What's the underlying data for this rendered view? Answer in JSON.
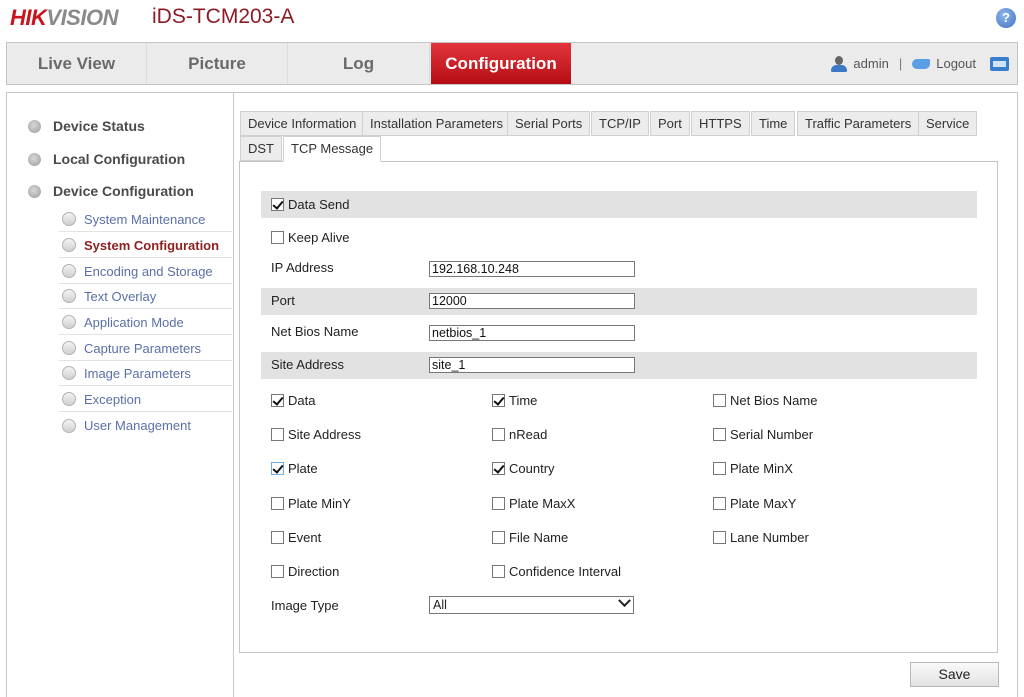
{
  "header": {
    "logo_part1": "HIK",
    "logo_part2": "VISION",
    "model": "iDS-TCM203-A",
    "help_label": "?"
  },
  "topnav": {
    "tabs": [
      {
        "label": "Live View",
        "active": false
      },
      {
        "label": "Picture",
        "active": false
      },
      {
        "label": "Log",
        "active": false
      },
      {
        "label": "Configuration",
        "active": true
      }
    ],
    "user": "admin",
    "separator": "|",
    "logout": "Logout"
  },
  "sidebar": {
    "top_items": [
      {
        "label": "Device Status"
      },
      {
        "label": "Local Configuration"
      },
      {
        "label": "Device Configuration"
      }
    ],
    "sub_items": [
      {
        "label": "System Maintenance",
        "active": false
      },
      {
        "label": "System Configuration",
        "active": true
      },
      {
        "label": "Encoding and Storage",
        "active": false
      },
      {
        "label": "Text Overlay",
        "active": false
      },
      {
        "label": "Application Mode",
        "active": false
      },
      {
        "label": "Capture Parameters",
        "active": false
      },
      {
        "label": "Image Parameters",
        "active": false
      },
      {
        "label": "Exception",
        "active": false
      },
      {
        "label": "User Management",
        "active": false
      }
    ]
  },
  "subtabs": [
    {
      "label": "Device Information",
      "active": false
    },
    {
      "label": "Installation Parameters",
      "active": false
    },
    {
      "label": "Serial Ports",
      "active": false
    },
    {
      "label": "TCP/IP",
      "active": false
    },
    {
      "label": "Port",
      "active": false
    },
    {
      "label": "HTTPS",
      "active": false
    },
    {
      "label": "Time",
      "active": false
    },
    {
      "label": "Traffic Parameters",
      "active": false
    },
    {
      "label": "Service",
      "active": false
    },
    {
      "label": "DST",
      "active": false
    },
    {
      "label": "TCP Message",
      "active": true
    }
  ],
  "form": {
    "data_send": {
      "label": "Data Send",
      "checked": true
    },
    "keep_alive": {
      "label": "Keep Alive",
      "checked": false
    },
    "ip_address": {
      "label": "IP Address",
      "value": "192.168.10.248"
    },
    "port": {
      "label": "Port",
      "value": "12000"
    },
    "net_bios_name": {
      "label": "Net Bios Name",
      "value": "netbios_1"
    },
    "site_address": {
      "label": "Site Address",
      "value": "site_1"
    },
    "fields": [
      {
        "label": "Data",
        "checked": true
      },
      {
        "label": "Time",
        "checked": true
      },
      {
        "label": "Net Bios Name",
        "checked": false
      },
      {
        "label": "Site Address",
        "checked": false
      },
      {
        "label": "nRead",
        "checked": false
      },
      {
        "label": "Serial Number",
        "checked": false
      },
      {
        "label": "Plate",
        "checked": true
      },
      {
        "label": "Country",
        "checked": true
      },
      {
        "label": "Plate MinX",
        "checked": false
      },
      {
        "label": "Plate MinY",
        "checked": false
      },
      {
        "label": "Plate MaxX",
        "checked": false
      },
      {
        "label": "Plate MaxY",
        "checked": false
      },
      {
        "label": "Event",
        "checked": false
      },
      {
        "label": "File Name",
        "checked": false
      },
      {
        "label": "Lane Number",
        "checked": false
      },
      {
        "label": "Direction",
        "checked": false
      },
      {
        "label": "Confidence Interval",
        "checked": false
      }
    ],
    "image_type": {
      "label": "Image Type",
      "value": "All"
    }
  },
  "actions": {
    "save": "Save"
  },
  "colors": {
    "accent": "#c8141e",
    "active_sidebar": "#8e1f1f",
    "sidebar_link": "#5b70a8"
  }
}
